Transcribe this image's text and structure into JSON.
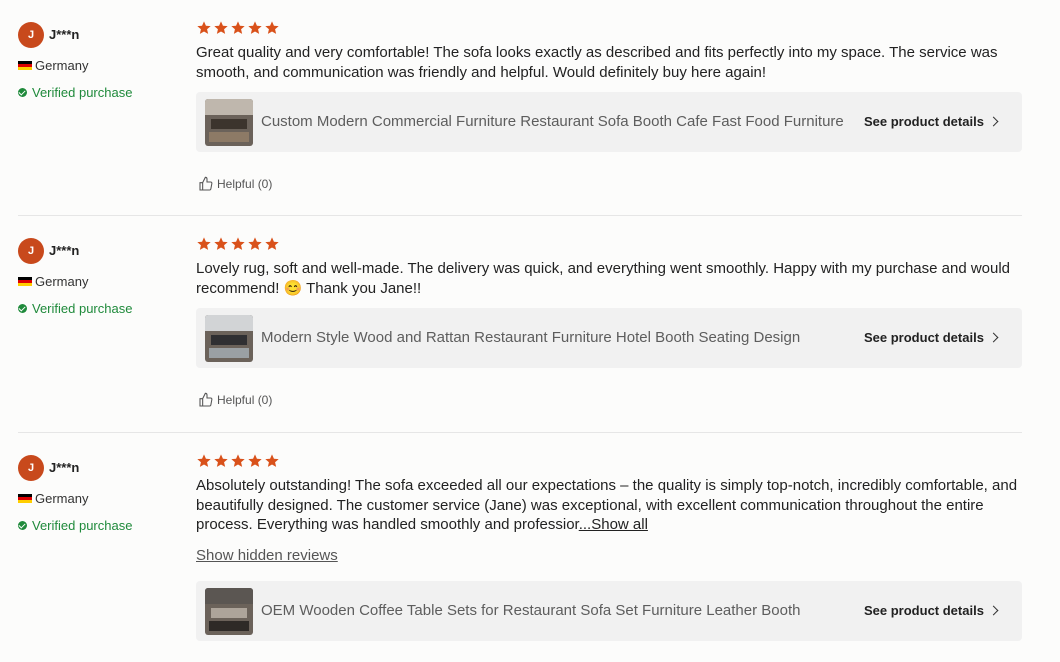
{
  "reviews": [
    {
      "avatar_letter": "J",
      "username": "J***n",
      "country": "Germany",
      "verified": "Verified purchase",
      "rating": 5,
      "text": "Great quality and very comfortable! The sofa looks exactly as described and fits perfectly into my space. The service was smooth, and communication was friendly and helpful. Would definitely buy here again!",
      "product_title": "Custom Modern Commercial Furniture Restaurant Sofa Booth Cafe Fast Food Furniture",
      "product_link": "See product details",
      "helpful": "Helpful (0)"
    },
    {
      "avatar_letter": "J",
      "username": "J***n",
      "country": "Germany",
      "verified": "Verified purchase",
      "rating": 5,
      "text": "Lovely rug, soft and well-made. The delivery was quick, and everything went smoothly. Happy with my purchase and would recommend! 😊 Thank you Jane!!",
      "product_title": "Modern Style Wood and Rattan Restaurant Furniture Hotel Booth Seating Design",
      "product_link": "See product details",
      "helpful": "Helpful (0)"
    },
    {
      "avatar_letter": "J",
      "username": "J***n",
      "country": "Germany",
      "verified": "Verified purchase",
      "rating": 5,
      "text": "Absolutely outstanding! The sofa exceeded all our expectations – the quality is simply top-notch, incredibly comfortable, and beautifully designed. The customer service (Jane) was exceptional, with excellent communication throughout the entire process. Everything was handled smoothly and professior",
      "show_all": "...Show all",
      "hidden_reviews": "Show hidden reviews",
      "product_title": "OEM Wooden Coffee Table Sets for Restaurant Sofa Set Furniture Leather Booth",
      "product_link": "See product details"
    }
  ],
  "colors": {
    "accent": "#d9511a",
    "avatar": "#c8491c",
    "verified": "#1f8a3b",
    "card": "#f1f1f1"
  },
  "icons": {
    "star": "star-icon",
    "check": "check-circle-icon",
    "thumb": "thumbs-up-icon",
    "chevron": "chevron-right-icon"
  }
}
